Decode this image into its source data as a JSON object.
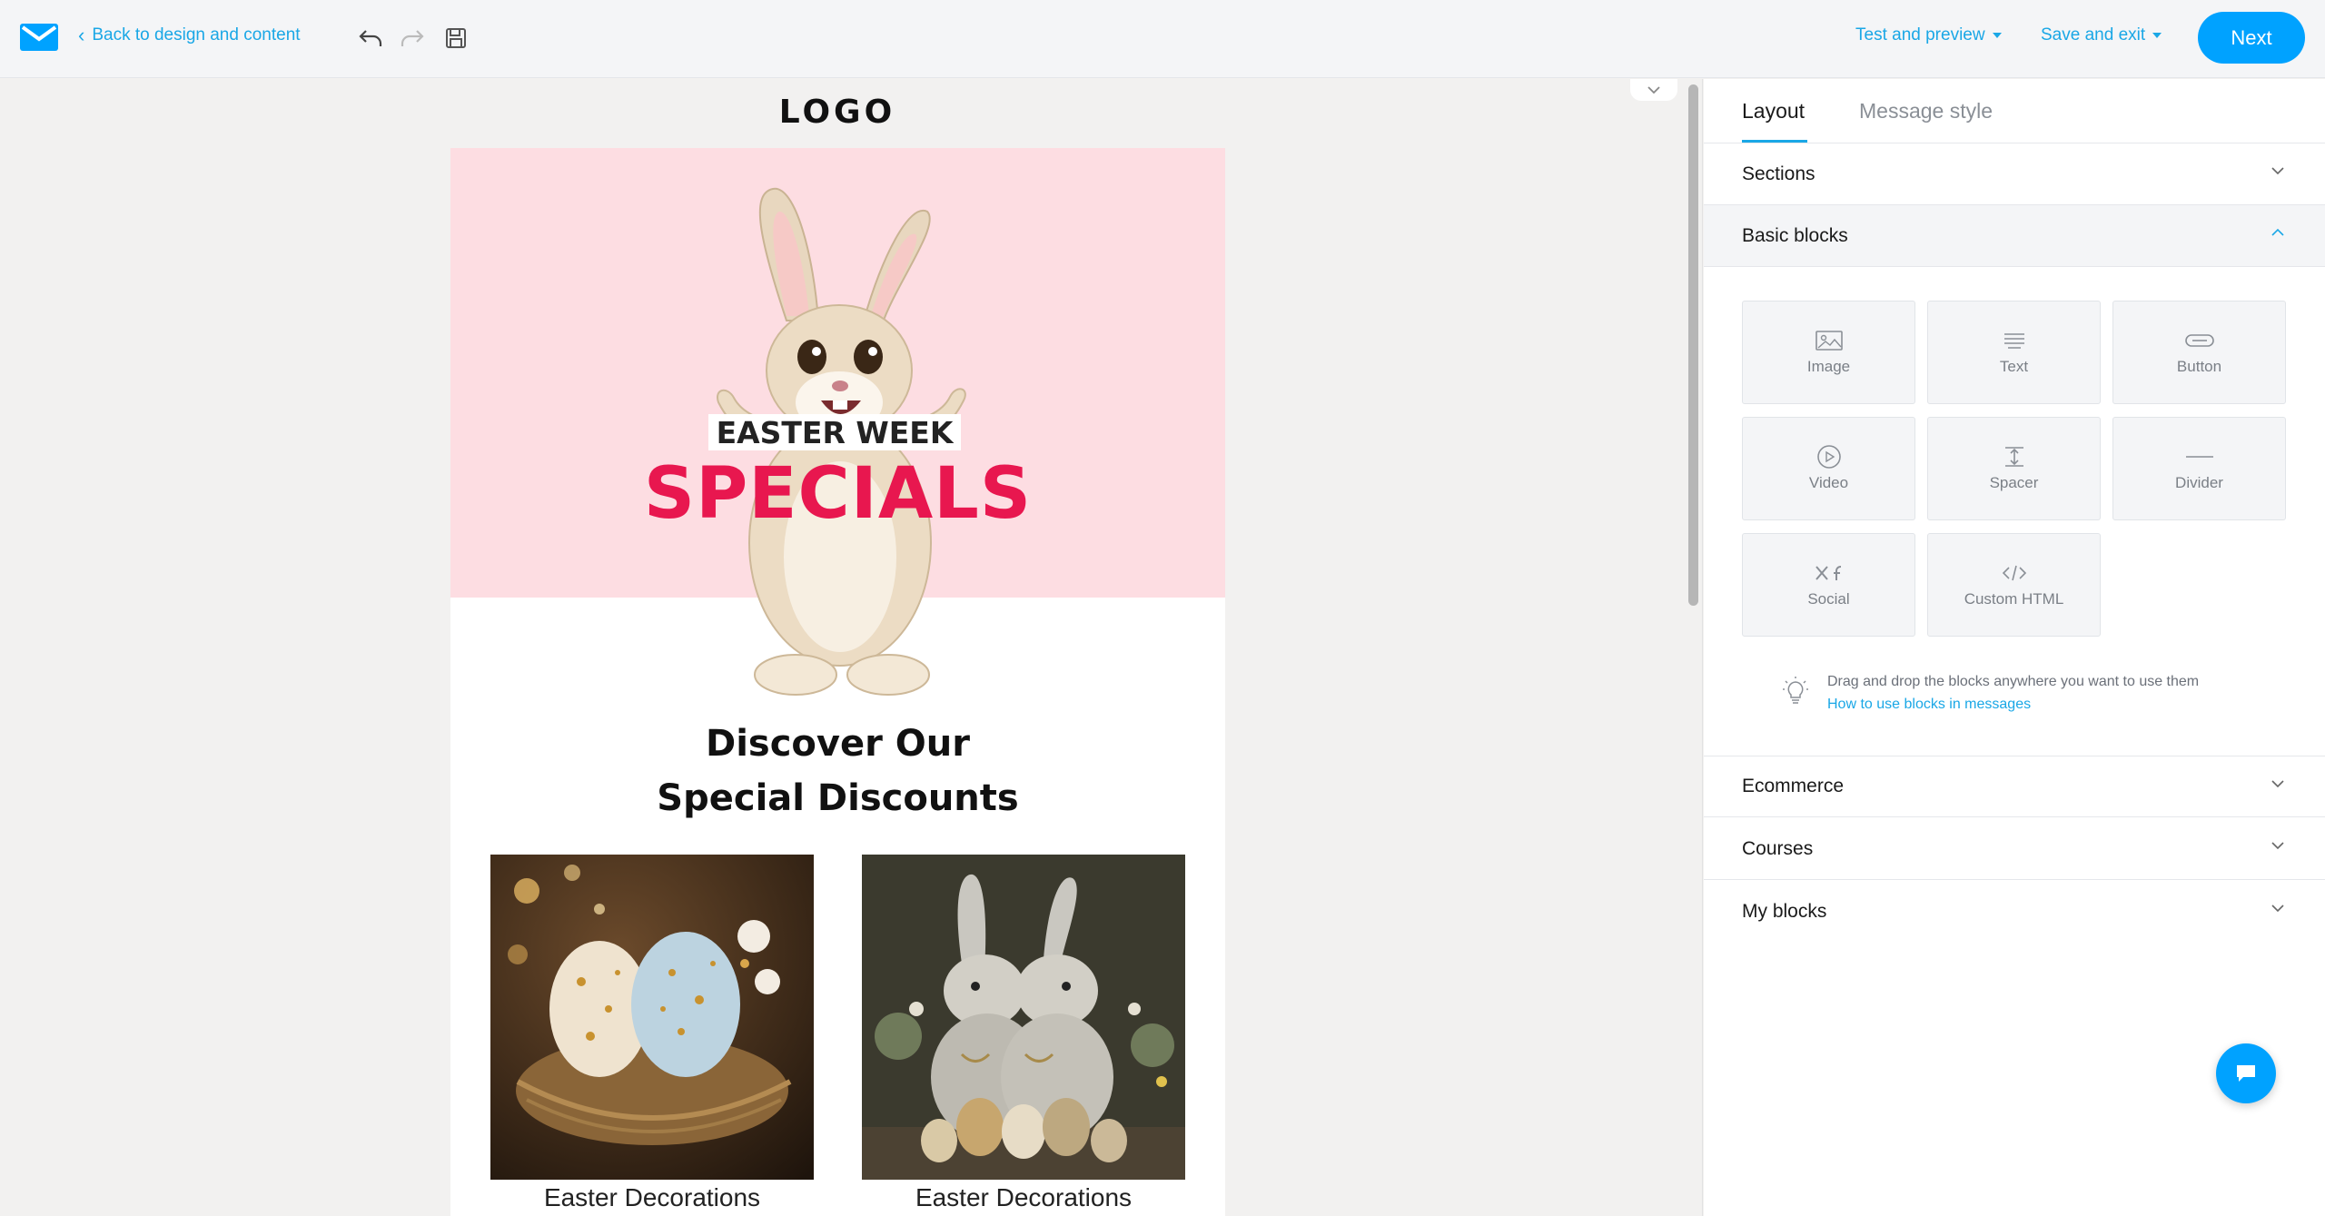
{
  "topbar": {
    "back_label": "Back to design and content",
    "test_preview_label": "Test and preview",
    "save_exit_label": "Save and exit",
    "next_label": "Next",
    "accent_color": "#00a2ff"
  },
  "email": {
    "logo_text": "LOGO",
    "hero_badge": "EASTER WEEK",
    "hero_title": "SPECIALS",
    "hero_bg": "#fddde2",
    "title_color": "#e8174f",
    "discover_line1": "Discover Our",
    "discover_line2": "Special Discounts",
    "products": [
      {
        "caption": "Easter Decorations"
      },
      {
        "caption": "Easter Decorations"
      }
    ]
  },
  "panel": {
    "tabs": [
      {
        "label": "Layout",
        "active": true
      },
      {
        "label": "Message style",
        "active": false
      }
    ],
    "sections": [
      {
        "label": "Sections",
        "open": false
      },
      {
        "label": "Basic blocks",
        "open": true
      },
      {
        "label": "Ecommerce",
        "open": false
      },
      {
        "label": "Courses",
        "open": false
      },
      {
        "label": "My blocks",
        "open": false
      }
    ],
    "blocks": [
      {
        "label": "Image",
        "icon": "image-icon"
      },
      {
        "label": "Text",
        "icon": "text-icon"
      },
      {
        "label": "Button",
        "icon": "button-icon"
      },
      {
        "label": "Video",
        "icon": "video-icon"
      },
      {
        "label": "Spacer",
        "icon": "spacer-icon"
      },
      {
        "label": "Divider",
        "icon": "divider-icon"
      },
      {
        "label": "Social",
        "icon": "social-icon"
      },
      {
        "label": "Custom HTML",
        "icon": "code-icon"
      }
    ],
    "hint_text": "Drag and drop the blocks anywhere you want to use them",
    "hint_link": "How to use blocks in messages"
  }
}
